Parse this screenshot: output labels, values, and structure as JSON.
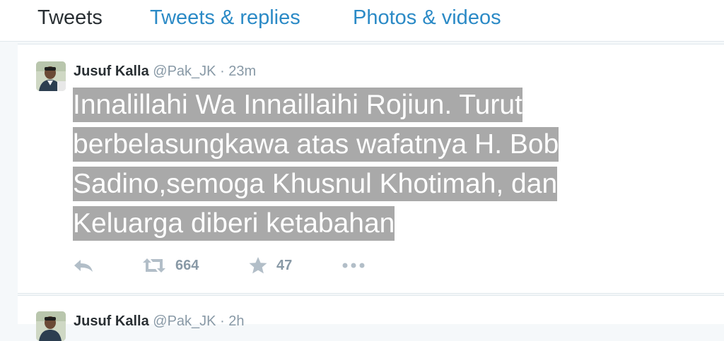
{
  "tabs": {
    "tweets": "Tweets",
    "replies": "Tweets & replies",
    "photos": "Photos & videos"
  },
  "tweet": {
    "name": "Jusuf Kalla",
    "handle": "@Pak_JK",
    "separator": "·",
    "time": "23m",
    "text": "Innalillahi Wa Innaillaihi Rojiun. Turut berbelasungkawa atas wafatnya H. Bob Sadino,semoga Khusnul Khotimah, dan Keluarga diberi ketabahan",
    "retweets": "664",
    "favorites": "47"
  },
  "tweet2": {
    "name": "Jusuf Kalla",
    "handle": "@Pak_JK",
    "separator": "·",
    "time": "2h"
  },
  "colors": {
    "link": "#2b8ac6",
    "muted": "#8899a6",
    "text": "#292f33",
    "highlight": "#a9a9a9",
    "border": "#e1e8ed"
  },
  "icons": {
    "reply": "reply-icon",
    "retweet": "retweet-icon",
    "favorite": "star-icon",
    "more": "more-dots-icon",
    "avatar": "profile-photo"
  }
}
